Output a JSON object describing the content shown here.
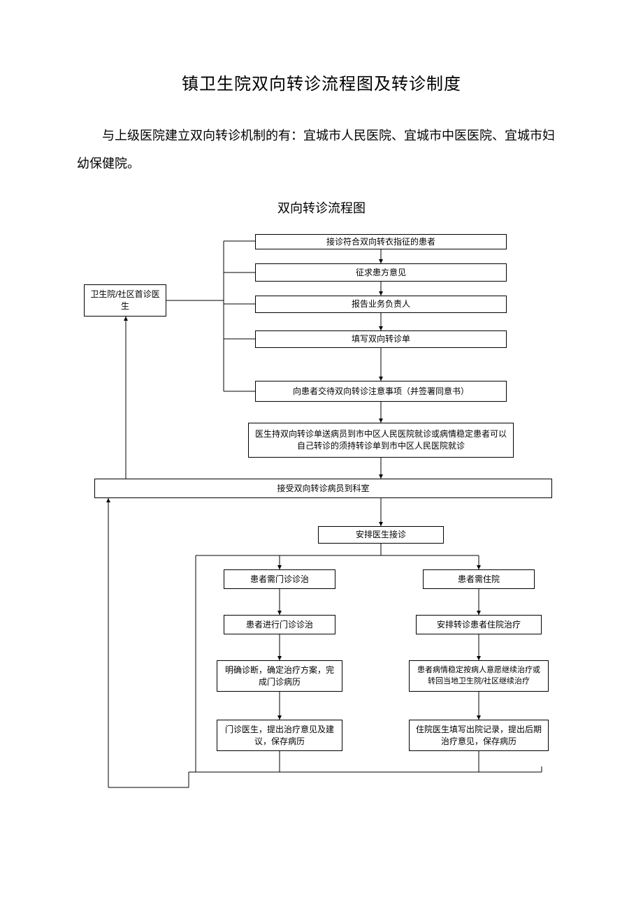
{
  "title": "镇卫生院双向转诊流程图及转诊制度",
  "intro": "与上级医院建立双向转诊机制的有：宜城市人民医院、宜城市中医医院、宜城市妇幼保健院。",
  "subtitle": "双向转诊流程图",
  "nodes": {
    "n1": "接诊符合双向转衣指征的患者",
    "n2": "征求患方意见",
    "n3": "报告业务负责人",
    "n4": "填写双向转诊单",
    "n5": "向患者交待双向转诊注意事项（并签署同意书）",
    "n6": "医生持双向转诊单送病员到市中区人民医院就诊或病情稳定患者可以自己转诊的须持转诊单到市中区人民医院就诊",
    "n7": "接受双向转诊病员到科室",
    "n8": "安排医生接诊",
    "n9": "患者需门诊诊治",
    "n10": "患者进行门诊诊治",
    "n11": "明确诊断，确定治疗方案，完成门诊病历",
    "n12": "门诊医生，提出治疗意见及建议，保存病历",
    "n13": "患者需住院",
    "n14": "安排转诊患者住院治疗",
    "n15": "患者病情稳定按病人意愿继续治疗或转回当地卫生院/社区继续治疗",
    "n16": "住院医生填写出院记录，提出后期治疗意见，保存病历",
    "left": "卫生院/社区首诊医生"
  }
}
